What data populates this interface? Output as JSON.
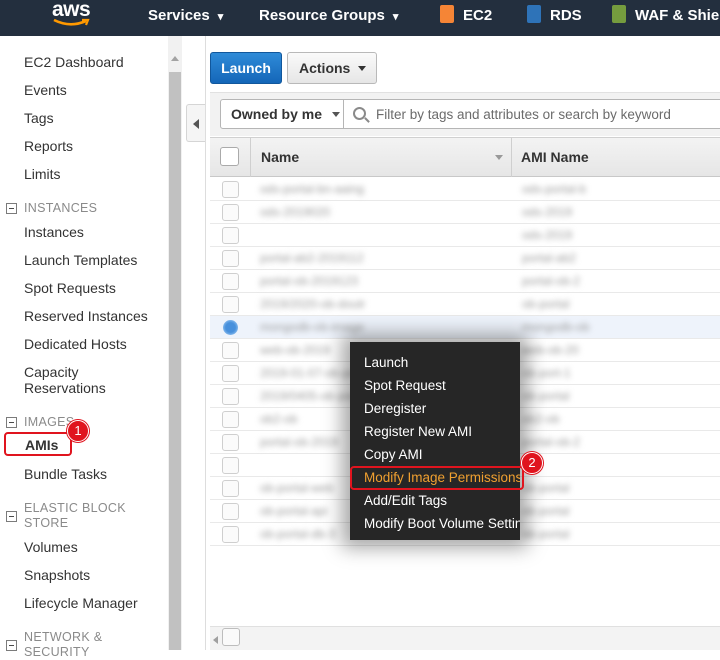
{
  "topnav": {
    "logo": "aws",
    "services_label": "Services",
    "resource_groups_label": "Resource Groups",
    "shortcuts": [
      {
        "label": "EC2",
        "icon": "ec2-icon",
        "color": "#f58536"
      },
      {
        "label": "RDS",
        "icon": "rds-icon",
        "color": "#2e73b8"
      },
      {
        "label": "WAF & Shie",
        "icon": "waf-icon",
        "color": "#759c3e"
      }
    ]
  },
  "sidebar": {
    "links_top": [
      "EC2 Dashboard",
      "Events",
      "Tags",
      "Reports",
      "Limits"
    ],
    "instances_header": "INSTANCES",
    "instances": [
      "Instances",
      "Launch Templates",
      "Spot Requests",
      "Reserved Instances",
      "Dedicated Hosts",
      "Capacity",
      "Reservations"
    ],
    "images_header": "IMAGES",
    "images": [
      "AMIs",
      "Bundle Tasks"
    ],
    "ebs_header_1": "ELASTIC BLOCK",
    "ebs_header_2": "STORE",
    "ebs": [
      "Volumes",
      "Snapshots",
      "Lifecycle Manager"
    ],
    "network_header_1": "NETWORK &",
    "network_header_2": "SECURITY"
  },
  "annotations": {
    "step1": "1",
    "step2": "2"
  },
  "toolbar": {
    "launch_label": "Launch",
    "actions_label": "Actions"
  },
  "filter": {
    "owner_value": "Owned by me",
    "search_placeholder": "Filter by tags and attributes or search by keyword"
  },
  "table": {
    "columns": [
      "Name",
      "AMI Name"
    ],
    "selected_row_index": 7,
    "rows": [
      {
        "name": "ods-portal-bn-aaing",
        "ami": "ods-portal-b"
      },
      {
        "name": "ods-2019020",
        "ami": "ods-2019"
      },
      {
        "name": "",
        "ami": "ods-2019"
      },
      {
        "name": "portal-ab2-2019112",
        "ami": "portal-ab2"
      },
      {
        "name": "portal-ob-2019123",
        "ami": "portal-ob-2"
      },
      {
        "name": "2019/2020-ob-doutr",
        "ami": "ob-portal"
      },
      {
        "name": "mongodb-ob-image",
        "ami": "mongodb-ob"
      },
      {
        "name": "web-ob-2019",
        "ami": "web-ob-20"
      },
      {
        "name": "2019-01-07-ob-port",
        "ami": "ob-port-1"
      },
      {
        "name": "2019/0405-ob-portal",
        "ami": "ob-portal"
      },
      {
        "name": "ob2-ob",
        "ami": "ob2-ob"
      },
      {
        "name": "portal-ob-2019",
        "ami": "portal-ob-2"
      },
      {
        "name": "",
        "ami": ""
      },
      {
        "name": "ob-portal-web",
        "ami": "ob-portal"
      },
      {
        "name": "ob-portal-api",
        "ami": "ob-portal"
      },
      {
        "name": "ob-portal-db-3",
        "ami": "ob-portal"
      }
    ]
  },
  "context_menu": {
    "items": [
      "Launch",
      "Spot Request",
      "Deregister",
      "Register New AMI",
      "Copy AMI",
      "Modify Image Permissions",
      "Add/Edit Tags",
      "Modify Boot Volume Setting"
    ],
    "highlighted": "Modify Image Permissions",
    "highlight_color": "#f0a030"
  }
}
